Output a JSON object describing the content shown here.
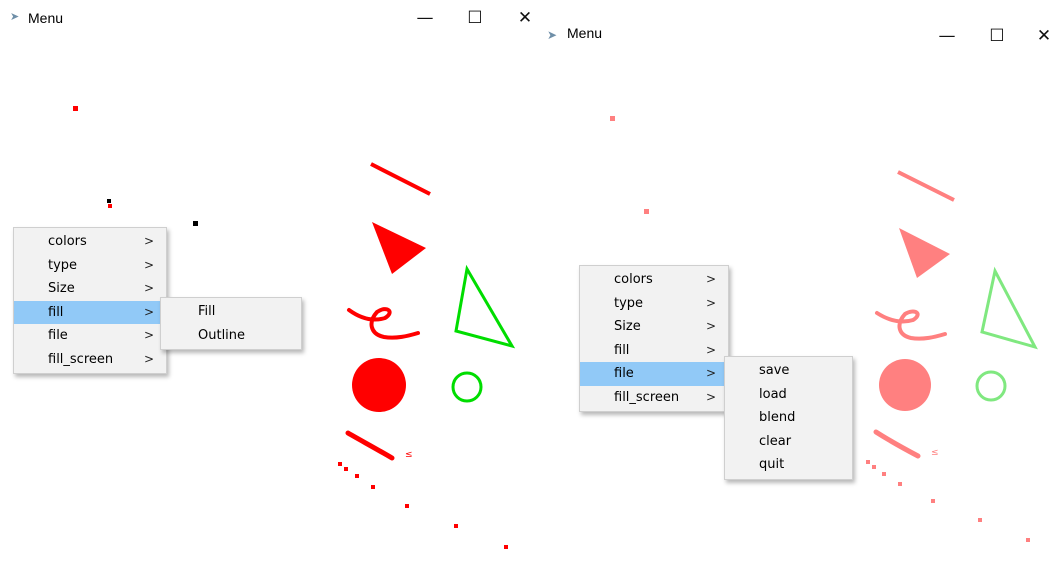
{
  "left_window": {
    "title": "Menu",
    "icon": "feather-icon",
    "caption_buttons": {
      "minimize": "—",
      "maximize": "☐",
      "close": "✕"
    },
    "menu": {
      "items": [
        {
          "label": "colors",
          "arrow": ">"
        },
        {
          "label": "type",
          "arrow": ">"
        },
        {
          "label": "Size",
          "arrow": ">"
        },
        {
          "label": "fill",
          "arrow": ">"
        },
        {
          "label": "file",
          "arrow": ">"
        },
        {
          "label": "fill_screen",
          "arrow": ">"
        }
      ],
      "highlighted": "fill"
    },
    "submenu": {
      "items": [
        "Fill",
        "Outline"
      ]
    },
    "scribble_label": "≤"
  },
  "right_window": {
    "title": "Menu",
    "icon": "feather-icon",
    "caption_buttons": {
      "minimize": "—",
      "maximize": "☐",
      "close": "✕"
    },
    "menu": {
      "items": [
        {
          "label": "colors",
          "arrow": ">"
        },
        {
          "label": "type",
          "arrow": ">"
        },
        {
          "label": "Size",
          "arrow": ">"
        },
        {
          "label": "fill",
          "arrow": ">"
        },
        {
          "label": "file",
          "arrow": ">"
        },
        {
          "label": "fill_screen",
          "arrow": ">"
        }
      ],
      "highlighted": "file"
    },
    "submenu": {
      "items": [
        "save",
        "load",
        "blend",
        "clear",
        "quit"
      ]
    },
    "scribble_label": "≤"
  },
  "colors": {
    "highlight": "#91c9f7",
    "red": "#ff0000",
    "pink": "#ff8080",
    "green": "#00dd00",
    "light_green": "#80e880",
    "black": "#000000"
  }
}
